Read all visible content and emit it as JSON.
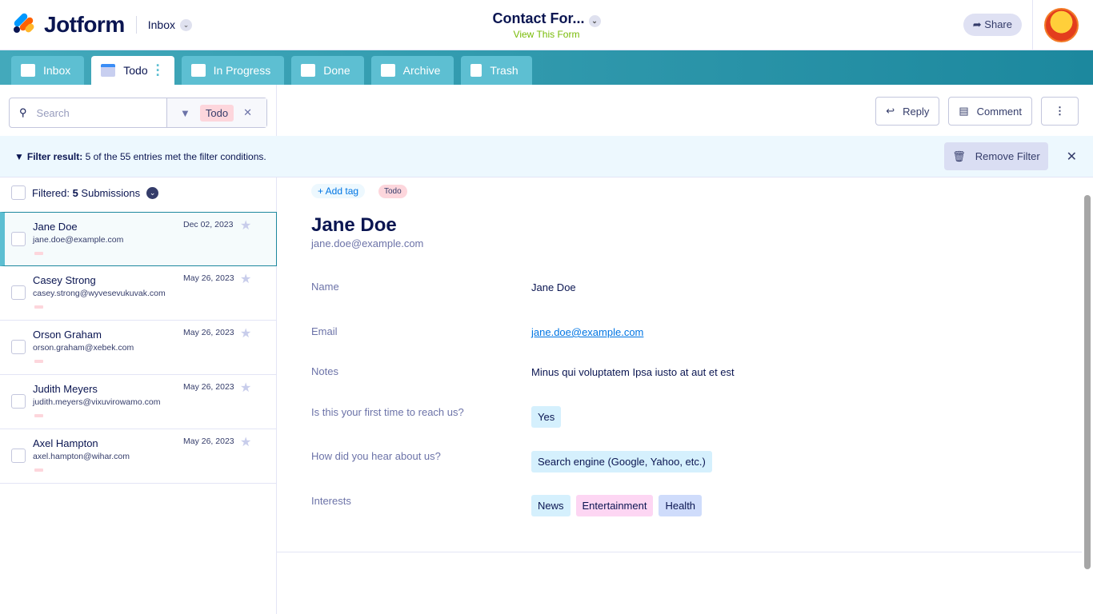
{
  "header": {
    "brand": "Jotform",
    "inbox_label": "Inbox",
    "form_title": "Contact For...",
    "view_form": "View This Form",
    "share": "Share"
  },
  "tabs": [
    {
      "label": "Inbox"
    },
    {
      "label": "Todo"
    },
    {
      "label": "In Progress"
    },
    {
      "label": "Done"
    },
    {
      "label": "Archive"
    },
    {
      "label": "Trash"
    }
  ],
  "search": {
    "placeholder": "Search",
    "filter_chip": "Todo"
  },
  "filter_bar": {
    "bold": "Filter result:",
    "text": " 5 of the 55 entries met the filter conditions.",
    "remove": "Remove Filter"
  },
  "list_header": {
    "prefix": "Filtered: ",
    "count": "5",
    "suffix": " Submissions"
  },
  "submissions": [
    {
      "name": "Jane Doe",
      "email": "jane.doe@example.com",
      "date": "Dec 02, 2023"
    },
    {
      "name": "Casey Strong",
      "email": "casey.strong@wyvesevukuvak.com",
      "date": "May 26, 2023"
    },
    {
      "name": "Orson Graham",
      "email": "orson.graham@xebek.com",
      "date": "May 26, 2023"
    },
    {
      "name": "Judith Meyers",
      "email": "judith.meyers@vixuvirowamo.com",
      "date": "May 26, 2023"
    },
    {
      "name": "Axel Hampton",
      "email": "axel.hampton@wihar.com",
      "date": "May 26, 2023"
    }
  ],
  "actions": {
    "reply": "Reply",
    "comment": "Comment"
  },
  "detail": {
    "add_tag": "+ Add tag",
    "tag": "Todo",
    "name": "Jane Doe",
    "email": "jane.doe@example.com",
    "fields": [
      {
        "label": "Name",
        "value": "Jane Doe"
      },
      {
        "label": "Email",
        "value": "jane.doe@example.com"
      },
      {
        "label": "Notes",
        "value": "Minus qui voluptatem Ipsa iusto at aut et est"
      },
      {
        "label": "Is this your first time to reach us?",
        "value": "Yes"
      },
      {
        "label": "How did you hear about us?",
        "value": "Search engine (Google, Yahoo, etc.)"
      },
      {
        "label": "Interests",
        "values": [
          "News",
          "Entertainment",
          "Health"
        ]
      }
    ]
  },
  "colors": {
    "teal": "#1c889e",
    "tab": "#5dbfd2",
    "navy": "#0a1551"
  }
}
